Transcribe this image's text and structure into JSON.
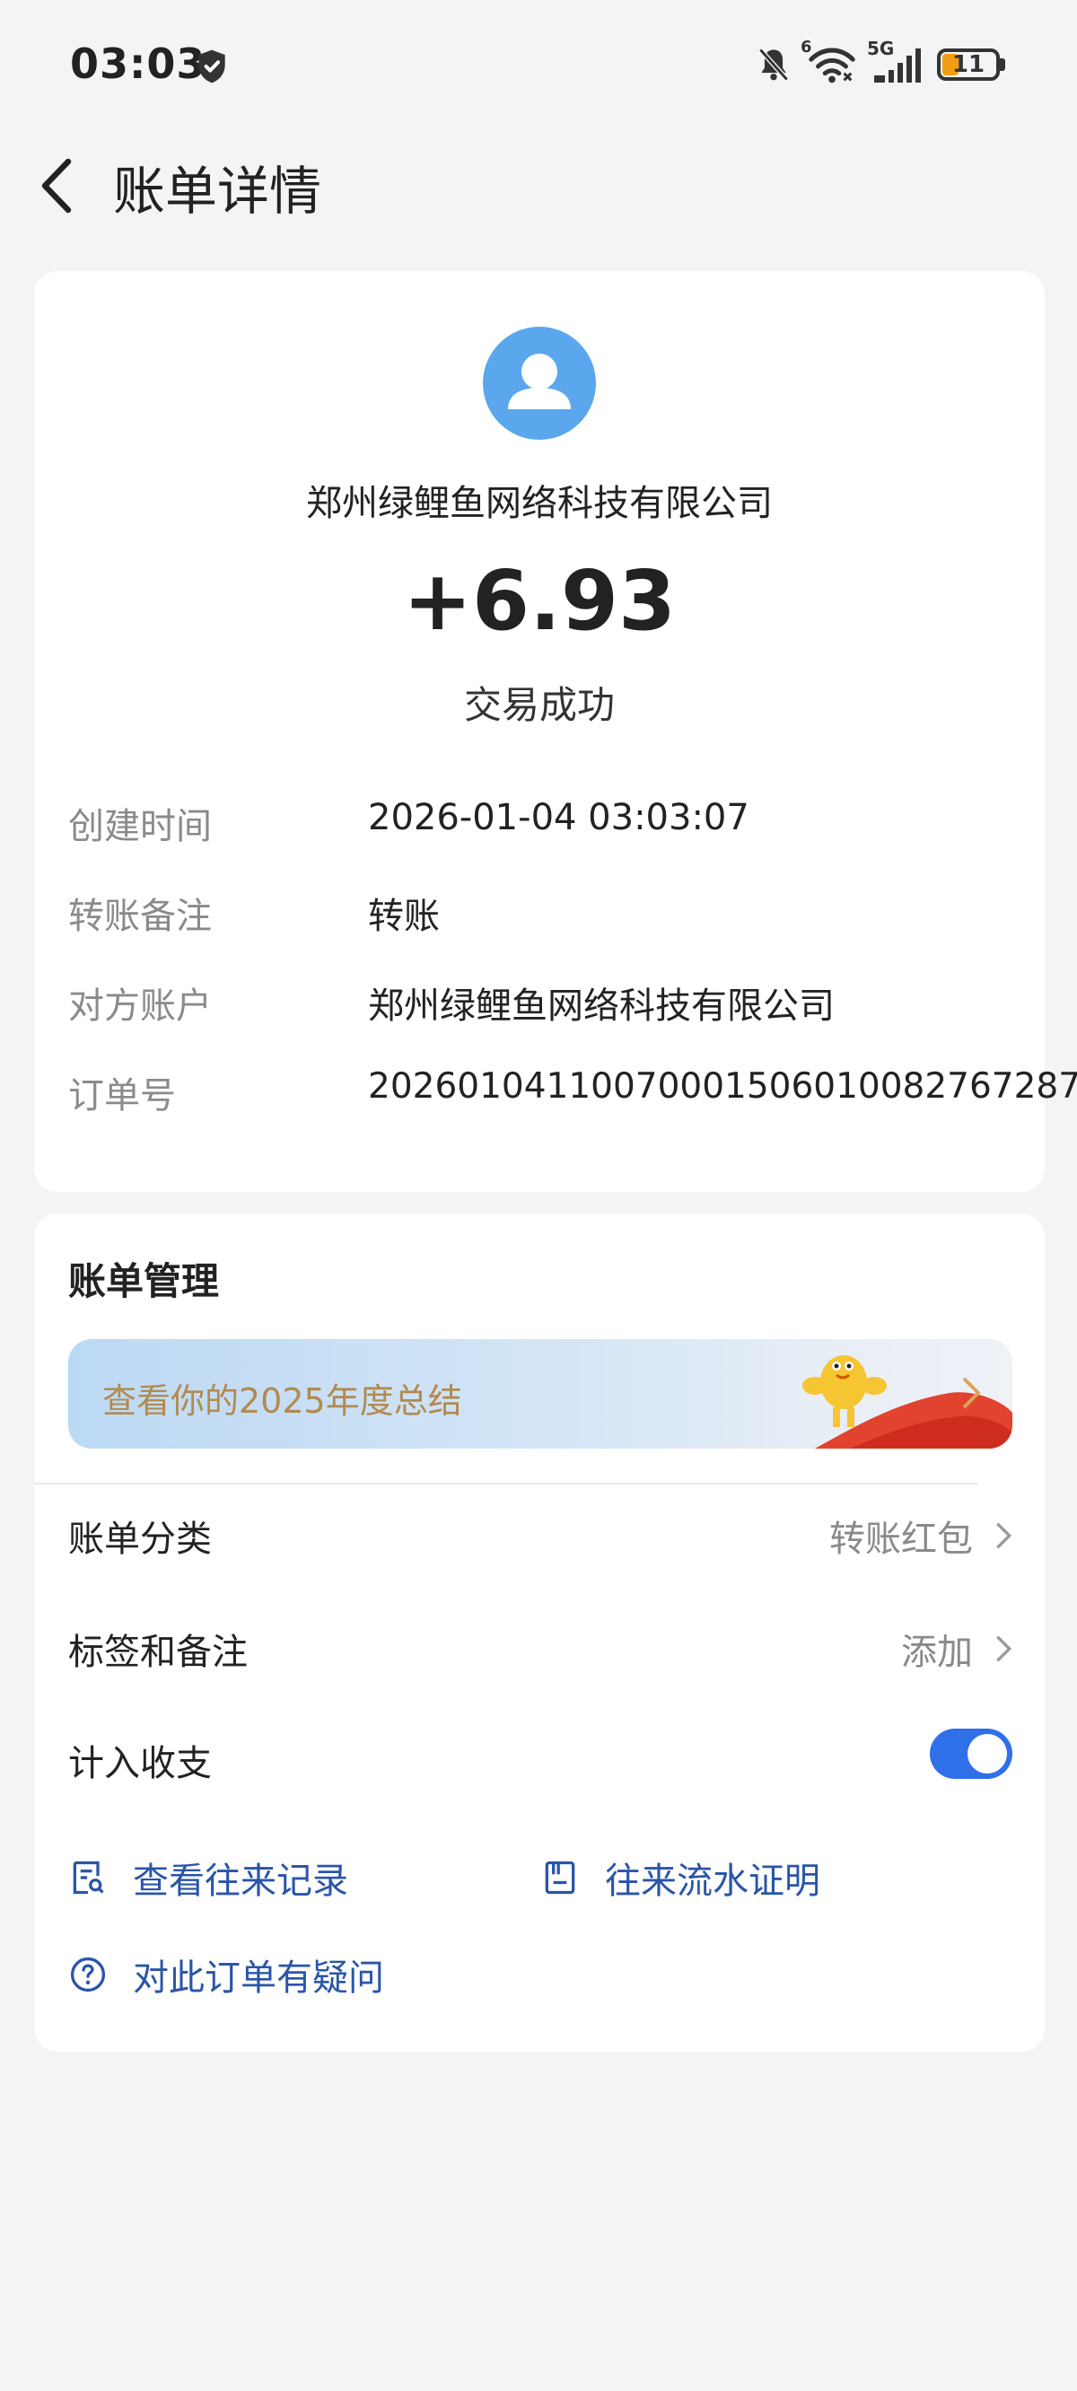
{
  "status_bar": {
    "time": "03:03",
    "wifi_badge": "6",
    "signal_label": "5G",
    "battery_level": "11",
    "icons": [
      "shield-check-icon",
      "bell-off-icon",
      "wifi-icon",
      "cell-signal-icon",
      "battery-icon"
    ]
  },
  "nav": {
    "title": "账单详情",
    "back_icon": "chevron-left-icon"
  },
  "summary": {
    "avatar_icon": "user-avatar-icon",
    "payer": "郑州绿鲤鱼网络科技有限公司",
    "amount": "+6.93",
    "status": "交易成功"
  },
  "details": [
    {
      "label": "创建时间",
      "value": "2026-01-04 03:03:07"
    },
    {
      "label": "转账备注",
      "value": "转账"
    },
    {
      "label": "对方账户",
      "value": "郑州绿鲤鱼网络科技有限公司"
    },
    {
      "label": "订单号",
      "value": "2026010411007000150601008276728​7"
    }
  ],
  "management": {
    "title": "账单管理",
    "banner_text": "查看你的2025年度总结",
    "rows": [
      {
        "label": "账单分类",
        "value": "转账红包"
      },
      {
        "label": "标签和备注",
        "value": "添加"
      },
      {
        "label": "计入收支",
        "toggle_on": true
      }
    ],
    "links": [
      {
        "label": "查看往来记录",
        "icon": "record-search-icon"
      },
      {
        "label": "往来流水证明",
        "icon": "statement-icon"
      },
      {
        "label": "对此订单有疑问",
        "icon": "question-circle-icon"
      }
    ]
  },
  "colors": {
    "background": "#f4f4f4",
    "card": "#ffffff",
    "avatar": "#5aa7ee",
    "link": "#2a55a8",
    "toggle": "#2f6fe8",
    "banner_text": "#b38a4e"
  }
}
